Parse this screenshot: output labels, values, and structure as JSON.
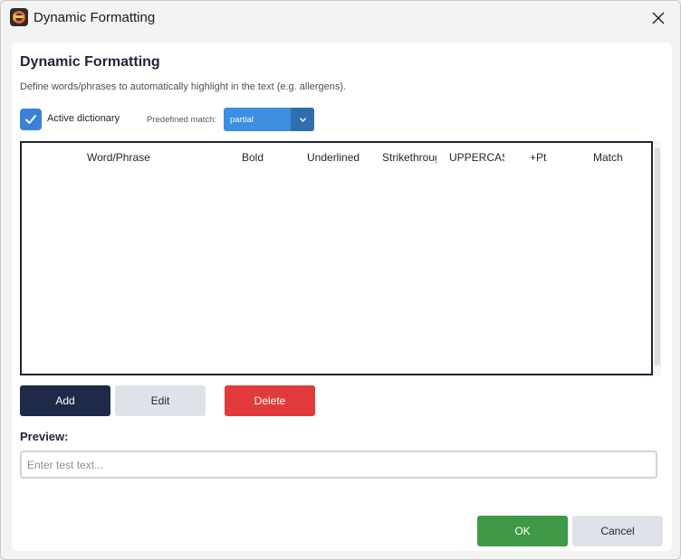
{
  "window": {
    "title": "Dynamic Formatting"
  },
  "dialog": {
    "heading": "Dynamic Formatting",
    "description": "Define words/phrases to automatically highlight in the text (e.g. allergens).",
    "active_dictionary": {
      "label": "Active dictionary",
      "checked": true
    },
    "predefined_match": {
      "label": "Predefined match:",
      "value": "partial"
    }
  },
  "table": {
    "columns": [
      "Word/Phrase",
      "Bold",
      "Underlined",
      "Strikethrough",
      "UPPERCASE",
      "+Pt",
      "Match"
    ],
    "rows": []
  },
  "actions": {
    "add": "Add",
    "edit": "Edit",
    "delete": "Delete"
  },
  "preview": {
    "label": "Preview:",
    "placeholder": "Enter test text...",
    "value": ""
  },
  "footer": {
    "ok": "OK",
    "cancel": "Cancel"
  },
  "icons": {
    "app": "app-logo-icon",
    "close": "close-icon",
    "check": "checkmark-icon",
    "dropdown": "chevron-down-icon"
  },
  "colors": {
    "accent_blue": "#3b82d6",
    "primary_dark": "#1e2a47",
    "danger": "#e13a3a",
    "success": "#3e9a46",
    "neutral": "#dfe3e9"
  }
}
